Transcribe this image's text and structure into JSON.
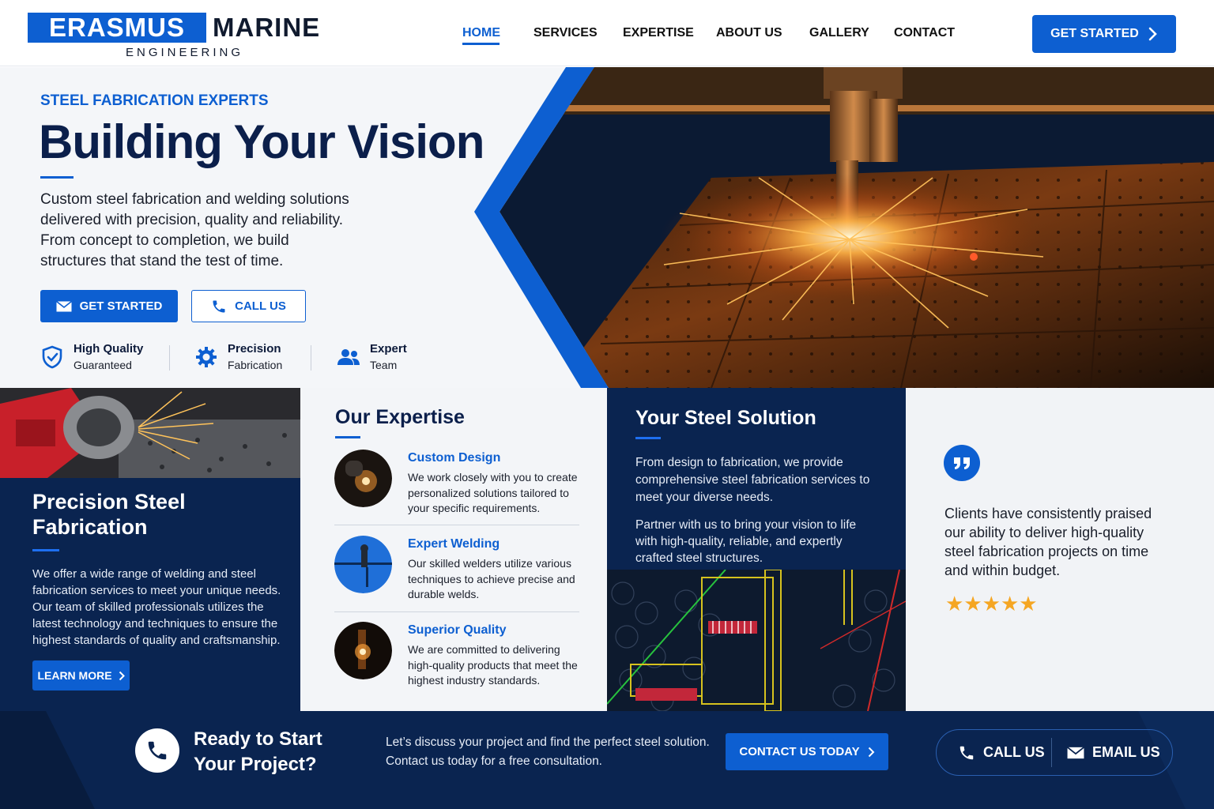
{
  "brand": {
    "name_part1": "ERASMUS",
    "name_part2": "MARINE",
    "tagline": "ENGINEERING",
    "colors": {
      "primary": "#0d5fd1",
      "navy": "#0a2450",
      "dark_heading": "#0b1f4b",
      "star": "#f5a623"
    }
  },
  "nav": {
    "items": [
      {
        "label": "HOME",
        "active": true
      },
      {
        "label": "SERVICES",
        "active": false
      },
      {
        "label": "EXPERTISE",
        "active": false
      },
      {
        "label": "ABOUT US",
        "active": false
      },
      {
        "label": "GALLERY",
        "active": false
      },
      {
        "label": "CONTACT",
        "active": false
      }
    ],
    "cta_label": "GET STARTED"
  },
  "hero": {
    "eyebrow": "STEEL FABRICATION EXPERTS",
    "title": "Building Your Vision",
    "description": "Custom steel fabrication and welding solutions delivered with precision, quality and reliability. From concept to completion, we build structures that stand the test of time.",
    "primary_button": "GET STARTED",
    "secondary_button": "CALL US",
    "features": [
      {
        "icon": "shield-check-icon",
        "line1": "High Quality",
        "line2": "Guaranteed"
      },
      {
        "icon": "gear-icon",
        "line1": "Precision",
        "line2": "Fabrication"
      },
      {
        "icon": "team-icon",
        "line1": "Expert",
        "line2": "Team"
      }
    ]
  },
  "precision": {
    "title": "Precision Steel Fabrication",
    "description": "We offer a wide range of welding and steel fabrication services to meet your unique needs. Our team of skilled professionals utilizes the latest technology and techniques to ensure the highest standards of quality and craftsmanship.",
    "button": "LEARN MORE"
  },
  "expertise": {
    "title": "Our Expertise",
    "items": [
      {
        "title": "Custom Design",
        "description": "We work closely with you to create personalized solutions tailored to your specific requirements."
      },
      {
        "title": "Expert Welding",
        "description": "Our skilled welders utilize various techniques to achieve precise and durable welds."
      },
      {
        "title": "Superior Quality",
        "description": "We are committed to delivering high-quality products that meet the highest industry standards."
      }
    ]
  },
  "solution": {
    "title": "Your Steel Solution",
    "paragraph1": "From design to fabrication, we provide comprehensive steel fabrication services to meet your diverse needs.",
    "paragraph2": "Partner with us to bring your vision to life with high-quality, reliable, and expertly crafted steel structures."
  },
  "testimonial": {
    "quote_icon": "quote-icon",
    "text": "Clients have consistently praised our ability to deliver high-quality steel fabrication projects on time and within budget.",
    "rating": 5,
    "rating_max": 5
  },
  "cta": {
    "title": "Ready to Start Your Project?",
    "description": "Let’s discuss your project and find the perfect steel solution. Contact us today for a free consultation.",
    "button": "CONTACT US TODAY",
    "call_label": "CALL US",
    "email_label": "EMAIL US"
  }
}
